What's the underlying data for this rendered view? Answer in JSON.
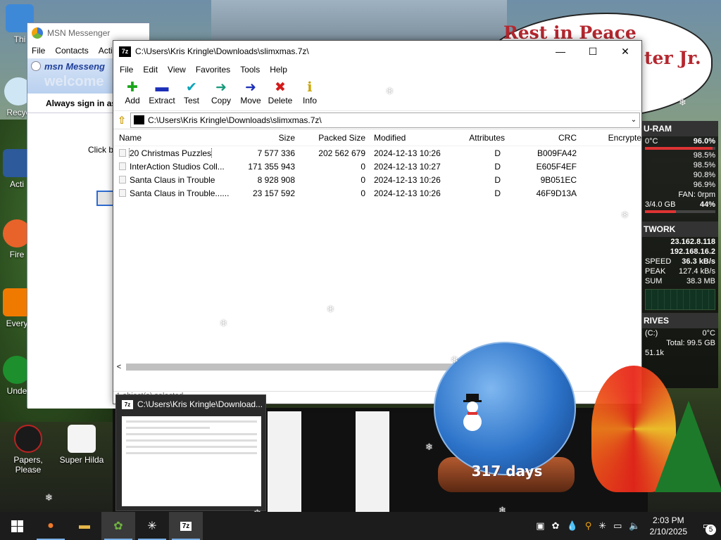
{
  "desktop": {
    "bubble_line1": "Rest in Peace",
    "bubble_line2": "ter Jr.",
    "icons": [
      {
        "label": "Thi"
      },
      {
        "label": "Recyc"
      },
      {
        "label": "Acti"
      },
      {
        "label": "Fire"
      },
      {
        "label": "Every"
      },
      {
        "label": "Unde"
      },
      {
        "label": "Papers, Please"
      },
      {
        "label": "Super Hilda"
      },
      {
        "label": "S T"
      }
    ]
  },
  "msn": {
    "title": "MSN Messenger",
    "menu": [
      "File",
      "Contacts",
      "Acti"
    ],
    "brand": "msn Messeng",
    "welcome": "welcome",
    "signin": "Always sign in as",
    "click": "Click be"
  },
  "zip": {
    "title": "C:\\Users\\Kris Kringle\\Downloads\\slimxmas.7z\\",
    "icon_text": "7z",
    "menu": [
      "File",
      "Edit",
      "View",
      "Favorites",
      "Tools",
      "Help"
    ],
    "toolbar": [
      {
        "label": "Add",
        "glyph": "✚",
        "color": "#1aa51a"
      },
      {
        "label": "Extract",
        "glyph": "▬",
        "color": "#1b2fb8"
      },
      {
        "label": "Test",
        "glyph": "✔",
        "color": "#0aa3b8"
      },
      {
        "label": "Copy",
        "glyph": "➜",
        "color": "#18997c"
      },
      {
        "label": "Move",
        "glyph": "➜",
        "color": "#1b2fb8"
      },
      {
        "label": "Delete",
        "glyph": "✖",
        "color": "#d41a1a"
      },
      {
        "label": "Info",
        "glyph": "ℹ",
        "color": "#c9a400"
      }
    ],
    "address": "C:\\Users\\Kris Kringle\\Downloads\\slimxmas.7z\\",
    "columns": {
      "name": "Name",
      "size": "Size",
      "packed": "Packed Size",
      "modified": "Modified",
      "attributes": "Attributes",
      "crc": "CRC",
      "encrypted": "Encrypte"
    },
    "rows": [
      {
        "name": "20 Christmas Puzzles",
        "size": "7 577 336",
        "packed": "202 562 679",
        "modified": "2024-12-13 10:26",
        "attr": "D",
        "crc": "B009FA42"
      },
      {
        "name": "InterAction Studios Coll...",
        "size": "171 355 943",
        "packed": "0",
        "modified": "2024-12-13 10:27",
        "attr": "D",
        "crc": "E605F4EF"
      },
      {
        "name": "Santa Claus in Trouble",
        "size": "8 928 908",
        "packed": "0",
        "modified": "2024-12-13 10:26",
        "attr": "D",
        "crc": "9B051EC"
      },
      {
        "name": "Santa Claus in Trouble......",
        "size": "23 157 592",
        "packed": "0",
        "modified": "2024-12-13 10:26",
        "attr": "D",
        "crc": "46F9D13A"
      }
    ],
    "status": "1 object(s) selected"
  },
  "preview": {
    "title": "C:\\Users\\Kris Kringle\\Download..."
  },
  "widget": {
    "cpu_head": "U-RAM",
    "cpu_temp": "0°C",
    "cpu_total": "96.0%",
    "cores": [
      "98.5%",
      "98.5%",
      "90.8%",
      "96.9%"
    ],
    "fan": "FAN: 0rpm",
    "ram": "3/4.0 GB",
    "ram_pct": "44%",
    "net_head": "TWORK",
    "ip1": "23.162.8.118",
    "ip2": "192.168.16.2",
    "speed_label": "SPEED",
    "speed": "36.3 kB/s",
    "peak_label": "PEAK",
    "peak": "127.4 kB/s",
    "sum_label": "SUM",
    "sum": "38.3 MB",
    "drives_head": "RIVES",
    "drive_c": "(C:)",
    "drive_temp": "0°C",
    "drive_total": "Total: 99.5 GB",
    "drive_free": "51.1k"
  },
  "globe": {
    "days": "317 days"
  },
  "taskbar": {
    "time": "2:03 PM",
    "date": "2/10/2025",
    "notifications": "5"
  }
}
